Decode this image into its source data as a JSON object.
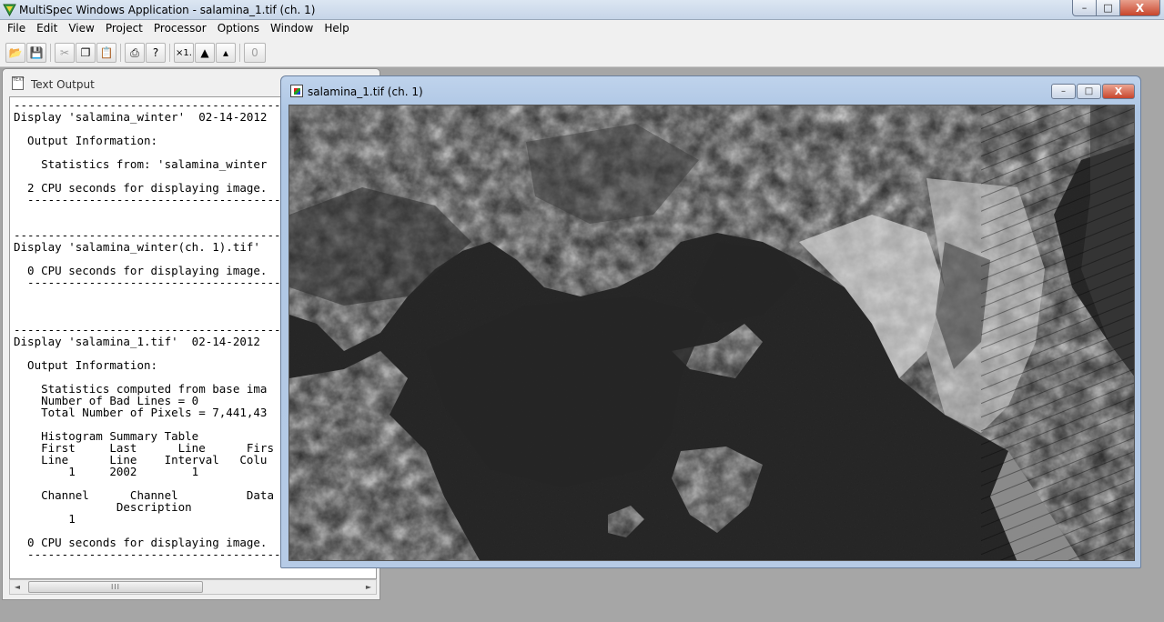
{
  "app": {
    "title": "MultiSpec Windows Application - salamina_1.tif (ch. 1)",
    "icon": "multispec-logo-icon",
    "controls": {
      "minimize": "–",
      "maximize": "□",
      "close": "X"
    }
  },
  "menu": [
    "File",
    "Edit",
    "View",
    "Project",
    "Processor",
    "Options",
    "Window",
    "Help"
  ],
  "toolbar": {
    "buttons": [
      {
        "name": "open-icon",
        "glyph": "📂",
        "enabled": true
      },
      {
        "name": "save-icon",
        "glyph": "💾",
        "enabled": false
      },
      {
        "name": "cut-icon",
        "glyph": "✂",
        "enabled": false
      },
      {
        "name": "copy-icon",
        "glyph": "❐",
        "enabled": true
      },
      {
        "name": "paste-icon",
        "glyph": "📋",
        "enabled": false
      },
      {
        "name": "print-icon",
        "glyph": "⎙",
        "enabled": true
      },
      {
        "name": "help-icon",
        "glyph": "?",
        "enabled": true
      },
      {
        "name": "zoom-x1-icon",
        "glyph": "×1.",
        "enabled": true
      },
      {
        "name": "zoom-in-icon",
        "glyph": "▲",
        "enabled": true
      },
      {
        "name": "zoom-out-icon",
        "glyph": "▴",
        "enabled": true
      },
      {
        "name": "overlay-icon",
        "glyph": "0",
        "enabled": false
      }
    ]
  },
  "text_output": {
    "title": "Text Output",
    "icon_label": "TEXT",
    "lines": [
      "-----------------------------------------------------------",
      "Display 'salamina_winter'  02-14-2012",
      "",
      "  Output Information:",
      "",
      "    Statistics from: 'salamina_winter",
      "",
      "  2 CPU seconds for displaying image.",
      "  -----------------------------------------------------------",
      "",
      "",
      "-----------------------------------------------------------",
      "Display 'salamina_winter(ch. 1).tif'",
      "",
      "  0 CPU seconds for displaying image.",
      "  -----------------------------------------------------------",
      "",
      "",
      "",
      "-----------------------------------------------------------",
      "Display 'salamina_1.tif'  02-14-2012",
      "",
      "  Output Information:",
      "",
      "    Statistics computed from base ima",
      "    Number of Bad Lines = 0",
      "    Total Number of Pixels = 7,441,43",
      "",
      "    Histogram Summary Table",
      "    First     Last      Line      Firs",
      "    Line      Line    Interval   Colu",
      "        1     2002        1",
      "",
      "    Channel      Channel          Data",
      "               Description",
      "        1",
      "",
      "  0 CPU seconds for displaying image.",
      "  -----------------------------------------------------------"
    ],
    "scroll": {
      "left": "◄",
      "right": "►",
      "down": "▼",
      "grip": "III"
    }
  },
  "image_window": {
    "title": "salamina_1.tif (ch. 1)",
    "controls": {
      "minimize": "–",
      "maximize": "□",
      "close": "X"
    }
  }
}
